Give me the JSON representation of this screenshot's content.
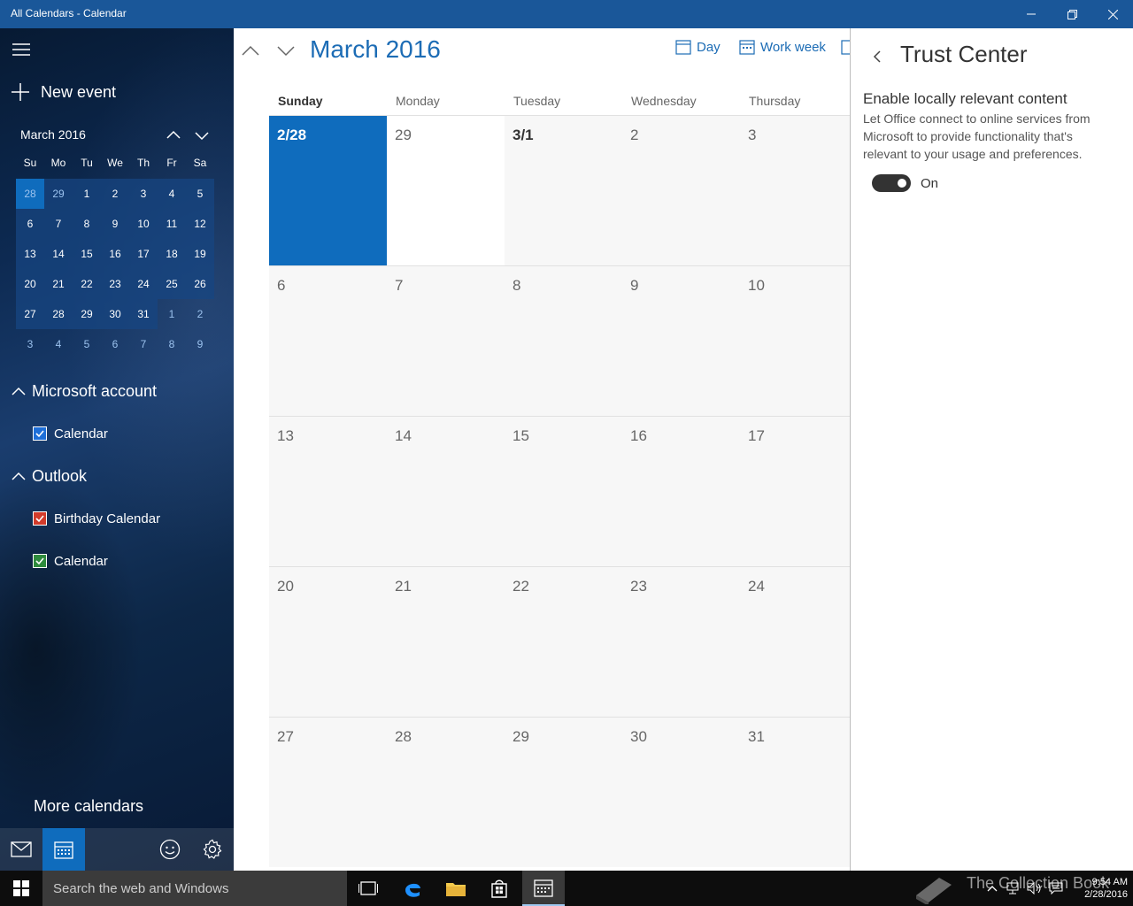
{
  "window": {
    "title": "All Calendars - Calendar"
  },
  "sidebar": {
    "new_event": "New event",
    "mini_month": "March 2016",
    "weekdays": [
      "Su",
      "Mo",
      "Tu",
      "We",
      "Th",
      "Fr",
      "Sa"
    ],
    "weeks": [
      [
        "28",
        "29",
        "1",
        "2",
        "3",
        "4",
        "5"
      ],
      [
        "6",
        "7",
        "8",
        "9",
        "10",
        "11",
        "12"
      ],
      [
        "13",
        "14",
        "15",
        "16",
        "17",
        "18",
        "19"
      ],
      [
        "20",
        "21",
        "22",
        "23",
        "24",
        "25",
        "26"
      ],
      [
        "27",
        "28",
        "29",
        "30",
        "31",
        "1",
        "2"
      ],
      [
        "3",
        "4",
        "5",
        "6",
        "7",
        "8",
        "9"
      ]
    ],
    "accounts": [
      {
        "name": "Microsoft account",
        "calendars": [
          {
            "label": "Calendar",
            "color": "#1e6fd9"
          }
        ]
      },
      {
        "name": "Outlook",
        "calendars": [
          {
            "label": "Birthday Calendar",
            "color": "#d13b2b"
          },
          {
            "label": "Calendar",
            "color": "#2e8b3d"
          }
        ]
      }
    ],
    "more_calendars": "More calendars"
  },
  "main": {
    "month_title": "March 2016",
    "views": {
      "day": "Day",
      "work_week": "Work week"
    },
    "days_of_week": [
      "Sunday",
      "Monday",
      "Tuesday",
      "Wednesday",
      "Thursday"
    ],
    "weeks": [
      [
        "2/28",
        "29",
        "3/1",
        "2",
        "3"
      ],
      [
        "6",
        "7",
        "8",
        "9",
        "10"
      ],
      [
        "13",
        "14",
        "15",
        "16",
        "17"
      ],
      [
        "20",
        "21",
        "22",
        "23",
        "24"
      ],
      [
        "27",
        "28",
        "29",
        "30",
        "31"
      ]
    ]
  },
  "trust_center": {
    "title": "Trust Center",
    "heading": "Enable locally relevant content",
    "description": "Let Office connect to online services from Microsoft to provide functionality that's relevant to your usage and preferences.",
    "toggle_label": "On",
    "toggle_on": true
  },
  "taskbar": {
    "search_placeholder": "Search the web and Windows",
    "time": "9:54 AM",
    "date": "2/28/2016",
    "watermark": "The Collection Book"
  },
  "colors": {
    "accent": "#0f6cbd",
    "title_bar": "#1a5799",
    "link": "#1c6cb5"
  }
}
